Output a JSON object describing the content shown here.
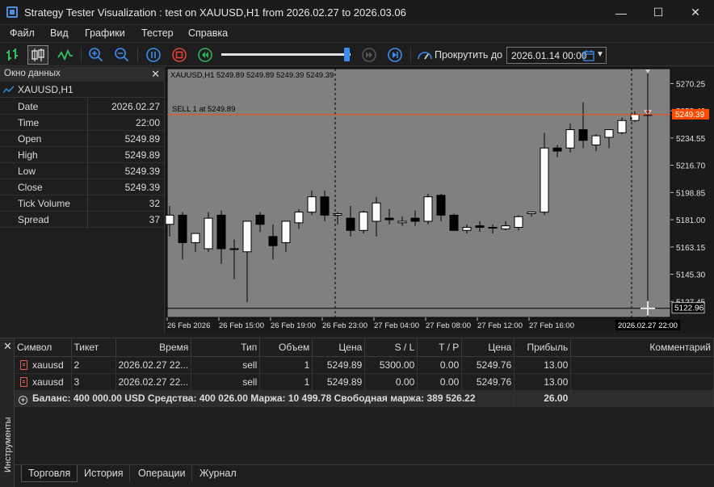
{
  "window": {
    "title": "Strategy Tester Visualization : test on XAUUSD,H1 from 2026.02.27 to 2026.03.06",
    "minimize": "—",
    "maximize": "☐",
    "close": "✕"
  },
  "menu": [
    "Файл",
    "Вид",
    "Графики",
    "Тестер",
    "Справка"
  ],
  "toolbar": {
    "scroll_label": "Прокрутить до",
    "scroll_date": "2026.01.14 00:00",
    "slider_fraction": 0.98
  },
  "datawindow": {
    "title": "Окно данных",
    "symbol": "XAUUSD,H1",
    "rows": [
      {
        "key": "Date",
        "value": "2026.02.27"
      },
      {
        "key": "Time",
        "value": "22:00"
      },
      {
        "key": "Open",
        "value": "5249.89"
      },
      {
        "key": "High",
        "value": "5249.89"
      },
      {
        "key": "Low",
        "value": "5249.39"
      },
      {
        "key": "Close",
        "value": "5249.39"
      },
      {
        "key": "Tick Volume",
        "value": "32"
      },
      {
        "key": "Spread",
        "value": "37"
      }
    ]
  },
  "chart": {
    "header": "XAUUSD,H1  5249.89 5249.89 5249.39 5249.39",
    "trade_label": "SELL 1 at 5249.89",
    "price_labels": [
      "5270.25",
      "5252.40",
      "5234.55",
      "5216.70",
      "5198.85",
      "5181.00",
      "5163.15",
      "5145.30",
      "5127.45"
    ],
    "current_price": "5249.39",
    "cursor_price": "5122.96",
    "time_labels": [
      "26 Feb 2026",
      "26 Feb 15:00",
      "26 Feb 19:00",
      "26 Feb 23:00",
      "27 Feb 04:00",
      "27 Feb 08:00",
      "27 Feb 12:00",
      "27 Feb 16:00"
    ],
    "cursor_time": "2026.02.27 22:00"
  },
  "chart_data": {
    "type": "candlestick",
    "symbol": "XAUUSD,H1",
    "ylim": [
      5117,
      5280
    ],
    "candles": [
      {
        "o": 5178,
        "h": 5190,
        "l": 5170,
        "c": 5184
      },
      {
        "o": 5184,
        "h": 5186,
        "l": 5155,
        "c": 5166
      },
      {
        "o": 5166,
        "h": 5172,
        "l": 5160,
        "c": 5172
      },
      {
        "o": 5162,
        "h": 5186,
        "l": 5160,
        "c": 5182
      },
      {
        "o": 5184,
        "h": 5187,
        "l": 5152,
        "c": 5162
      },
      {
        "o": 5162,
        "h": 5168,
        "l": 5142,
        "c": 5162
      },
      {
        "o": 5160,
        "h": 5180,
        "l": 5127,
        "c": 5180
      },
      {
        "o": 5184,
        "h": 5186,
        "l": 5173,
        "c": 5178
      },
      {
        "o": 5170,
        "h": 5178,
        "l": 5155,
        "c": 5164
      },
      {
        "o": 5166,
        "h": 5178,
        "l": 5160,
        "c": 5180
      },
      {
        "o": 5179,
        "h": 5188,
        "l": 5175,
        "c": 5186
      },
      {
        "o": 5186,
        "h": 5200,
        "l": 5184,
        "c": 5196
      },
      {
        "o": 5196,
        "h": 5200,
        "l": 5180,
        "c": 5184
      },
      {
        "o": 5184,
        "h": 5186,
        "l": 5178,
        "c": 5185
      },
      {
        "o": 5182,
        "h": 5190,
        "l": 5170,
        "c": 5174
      },
      {
        "o": 5174,
        "h": 5187,
        "l": 5172,
        "c": 5186
      },
      {
        "o": 5180,
        "h": 5196,
        "l": 5170,
        "c": 5192
      },
      {
        "o": 5182,
        "h": 5188,
        "l": 5178,
        "c": 5181
      },
      {
        "o": 5179,
        "h": 5183,
        "l": 5177,
        "c": 5180
      },
      {
        "o": 5182,
        "h": 5187,
        "l": 5177,
        "c": 5180
      },
      {
        "o": 5180,
        "h": 5198,
        "l": 5178,
        "c": 5196
      },
      {
        "o": 5197,
        "h": 5198,
        "l": 5180,
        "c": 5184
      },
      {
        "o": 5184,
        "h": 5185,
        "l": 5175,
        "c": 5174
      },
      {
        "o": 5174,
        "h": 5178,
        "l": 5172,
        "c": 5176
      },
      {
        "o": 5177,
        "h": 5180,
        "l": 5173,
        "c": 5176
      },
      {
        "o": 5176,
        "h": 5178,
        "l": 5172,
        "c": 5176
      },
      {
        "o": 5175,
        "h": 5180,
        "l": 5174,
        "c": 5177
      },
      {
        "o": 5176,
        "h": 5184,
        "l": 5174,
        "c": 5183
      },
      {
        "o": 5185,
        "h": 5186,
        "l": 5183,
        "c": 5186
      },
      {
        "o": 5186,
        "h": 5238,
        "l": 5184,
        "c": 5228
      },
      {
        "o": 5228,
        "h": 5230,
        "l": 5222,
        "c": 5226
      },
      {
        "o": 5228,
        "h": 5244,
        "l": 5225,
        "c": 5240
      },
      {
        "o": 5240,
        "h": 5258,
        "l": 5228,
        "c": 5233
      },
      {
        "o": 5230,
        "h": 5237,
        "l": 5226,
        "c": 5236
      },
      {
        "o": 5235,
        "h": 5240,
        "l": 5228,
        "c": 5240
      },
      {
        "o": 5238,
        "h": 5248,
        "l": 5237,
        "c": 5246
      },
      {
        "o": 5246,
        "h": 5252,
        "l": 5245,
        "c": 5250
      },
      {
        "o": 5249.89,
        "h": 5249.89,
        "l": 5249.39,
        "c": 5249.39
      }
    ]
  },
  "positions": {
    "headers": [
      "Символ",
      "Тикет",
      "Время",
      "Тип",
      "Объем",
      "Цена",
      "S / L",
      "T / P",
      "Цена",
      "Прибыль",
      "Комментарий"
    ],
    "rows": [
      [
        "xauusd",
        "2",
        "2026.02.27 22...",
        "sell",
        "1",
        "5249.89",
        "5300.00",
        "0.00",
        "5249.76",
        "13.00",
        ""
      ],
      [
        "xauusd",
        "3",
        "2026.02.27 22...",
        "sell",
        "1",
        "5249.89",
        "0.00",
        "0.00",
        "5249.76",
        "13.00",
        ""
      ]
    ],
    "balance_text": "Баланс: 400 000.00 USD  Средства: 400 026.00  Маржа: 10 499.78  Свободная маржа: 389 526.22",
    "total_profit": "26.00"
  },
  "bottom": {
    "strip_label": "Инструменты",
    "tabs": [
      "Торговля",
      "История",
      "Операции",
      "Журнал"
    ]
  },
  "colors": {
    "bull": "#ffffff",
    "bear": "#000000",
    "chart_bg": "#808080",
    "trade_line": "#ff4a00",
    "accent": "#3b8ef0",
    "stop_red": "#e04040",
    "play_green": "#30b060"
  }
}
